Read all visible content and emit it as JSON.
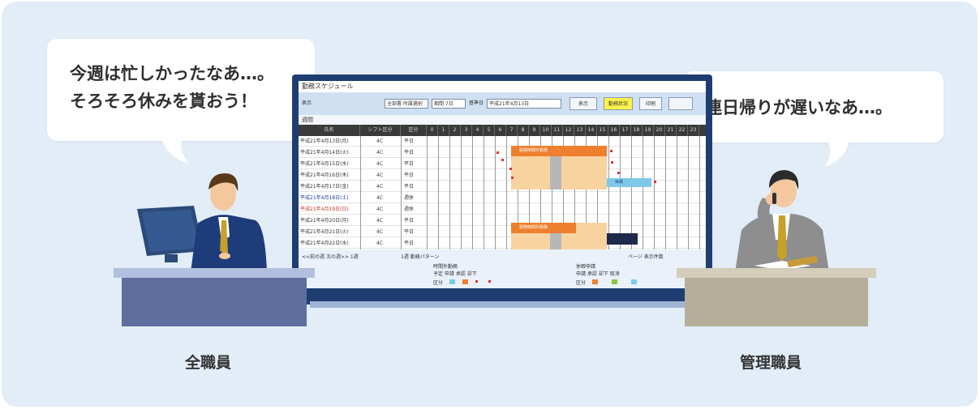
{
  "bubbles": {
    "left": {
      "line1": "今週は忙しかったなあ…。",
      "line2": "そろそろ休みを貰おう！"
    },
    "right": {
      "line1": "連日帰りが遅いなあ…。"
    }
  },
  "labels": {
    "left": "全職員",
    "right": "管理職員"
  },
  "app": {
    "title": "勤務スケジュール",
    "toolbar_label": "表示",
    "filter_select": "全部署 所属選択",
    "period_select": "期間 7日",
    "date_label": "基準日",
    "date_value": "平成21年4月13日",
    "btn_display": "表示",
    "btn_highlight": "勤務状況",
    "btn_print": "印刷",
    "sub_label": "週間",
    "header_name": "氏名",
    "header_shift": "シフト区分",
    "header_type": "区分",
    "header_hours": [
      "0",
      "1",
      "2",
      "3",
      "4",
      "5",
      "6",
      "7",
      "8",
      "9",
      "10",
      "11",
      "12",
      "13",
      "14",
      "15",
      "16",
      "17",
      "18",
      "19",
      "20",
      "21",
      "22",
      "23"
    ],
    "rows": [
      {
        "name": "平成21年4月13日(月)",
        "shift": "4C",
        "type": "平日"
      },
      {
        "name": "平成21年4月14日(火)",
        "shift": "4C",
        "type": "平日"
      },
      {
        "name": "平成21年4月15日(水)",
        "shift": "4C",
        "type": "平日"
      },
      {
        "name": "平成21年4月16日(木)",
        "shift": "4C",
        "type": "平日"
      },
      {
        "name": "平成21年4月17日(金)",
        "shift": "4C",
        "type": "平日"
      },
      {
        "name": "平成21年4月18日(土)",
        "shift": "4C",
        "type": "週休"
      },
      {
        "name": "平成21年4月19日(日)",
        "shift": "4C",
        "type": "週休"
      },
      {
        "name": "平成21年4月20日(月)",
        "shift": "4C",
        "type": "平日"
      },
      {
        "name": "平成21年4月21日(火)",
        "shift": "4C",
        "type": "平日"
      },
      {
        "name": "平成21年4月22日(水)",
        "shift": "4C",
        "type": "平日"
      }
    ],
    "bar_labels": {
      "top": "勤務時間外勤務",
      "middle": "勤務時間外勤務",
      "side": "休暇"
    },
    "footer": {
      "nav": "<<前の週  次の週>>  1週",
      "nav2": "1週 勤務パターン",
      "pager": "ページ  表示件数",
      "legend1_title": "時間外勤務",
      "legend1_sub": "予定 申請 承認 却下",
      "legend2_title": "休暇申請",
      "legend2_sub": "申請 承認 却下 取消",
      "legend_label": "区分"
    }
  },
  "colors": {
    "panel_bg": "#e2edf8",
    "monitor_frame": "#1e3e72",
    "orange_bar": "#ee7f2f",
    "peach_block": "#f7d3a0",
    "gray_block": "#b7b7b7",
    "blue_bar": "#7ec8ea",
    "navy_block": "#1e2a4a",
    "desk_left_body": "#5e6f9e",
    "desk_left_top": "#b3bfdf",
    "desk_right_body": "#b5ae9a",
    "desk_right_top": "#d3cdb9"
  }
}
